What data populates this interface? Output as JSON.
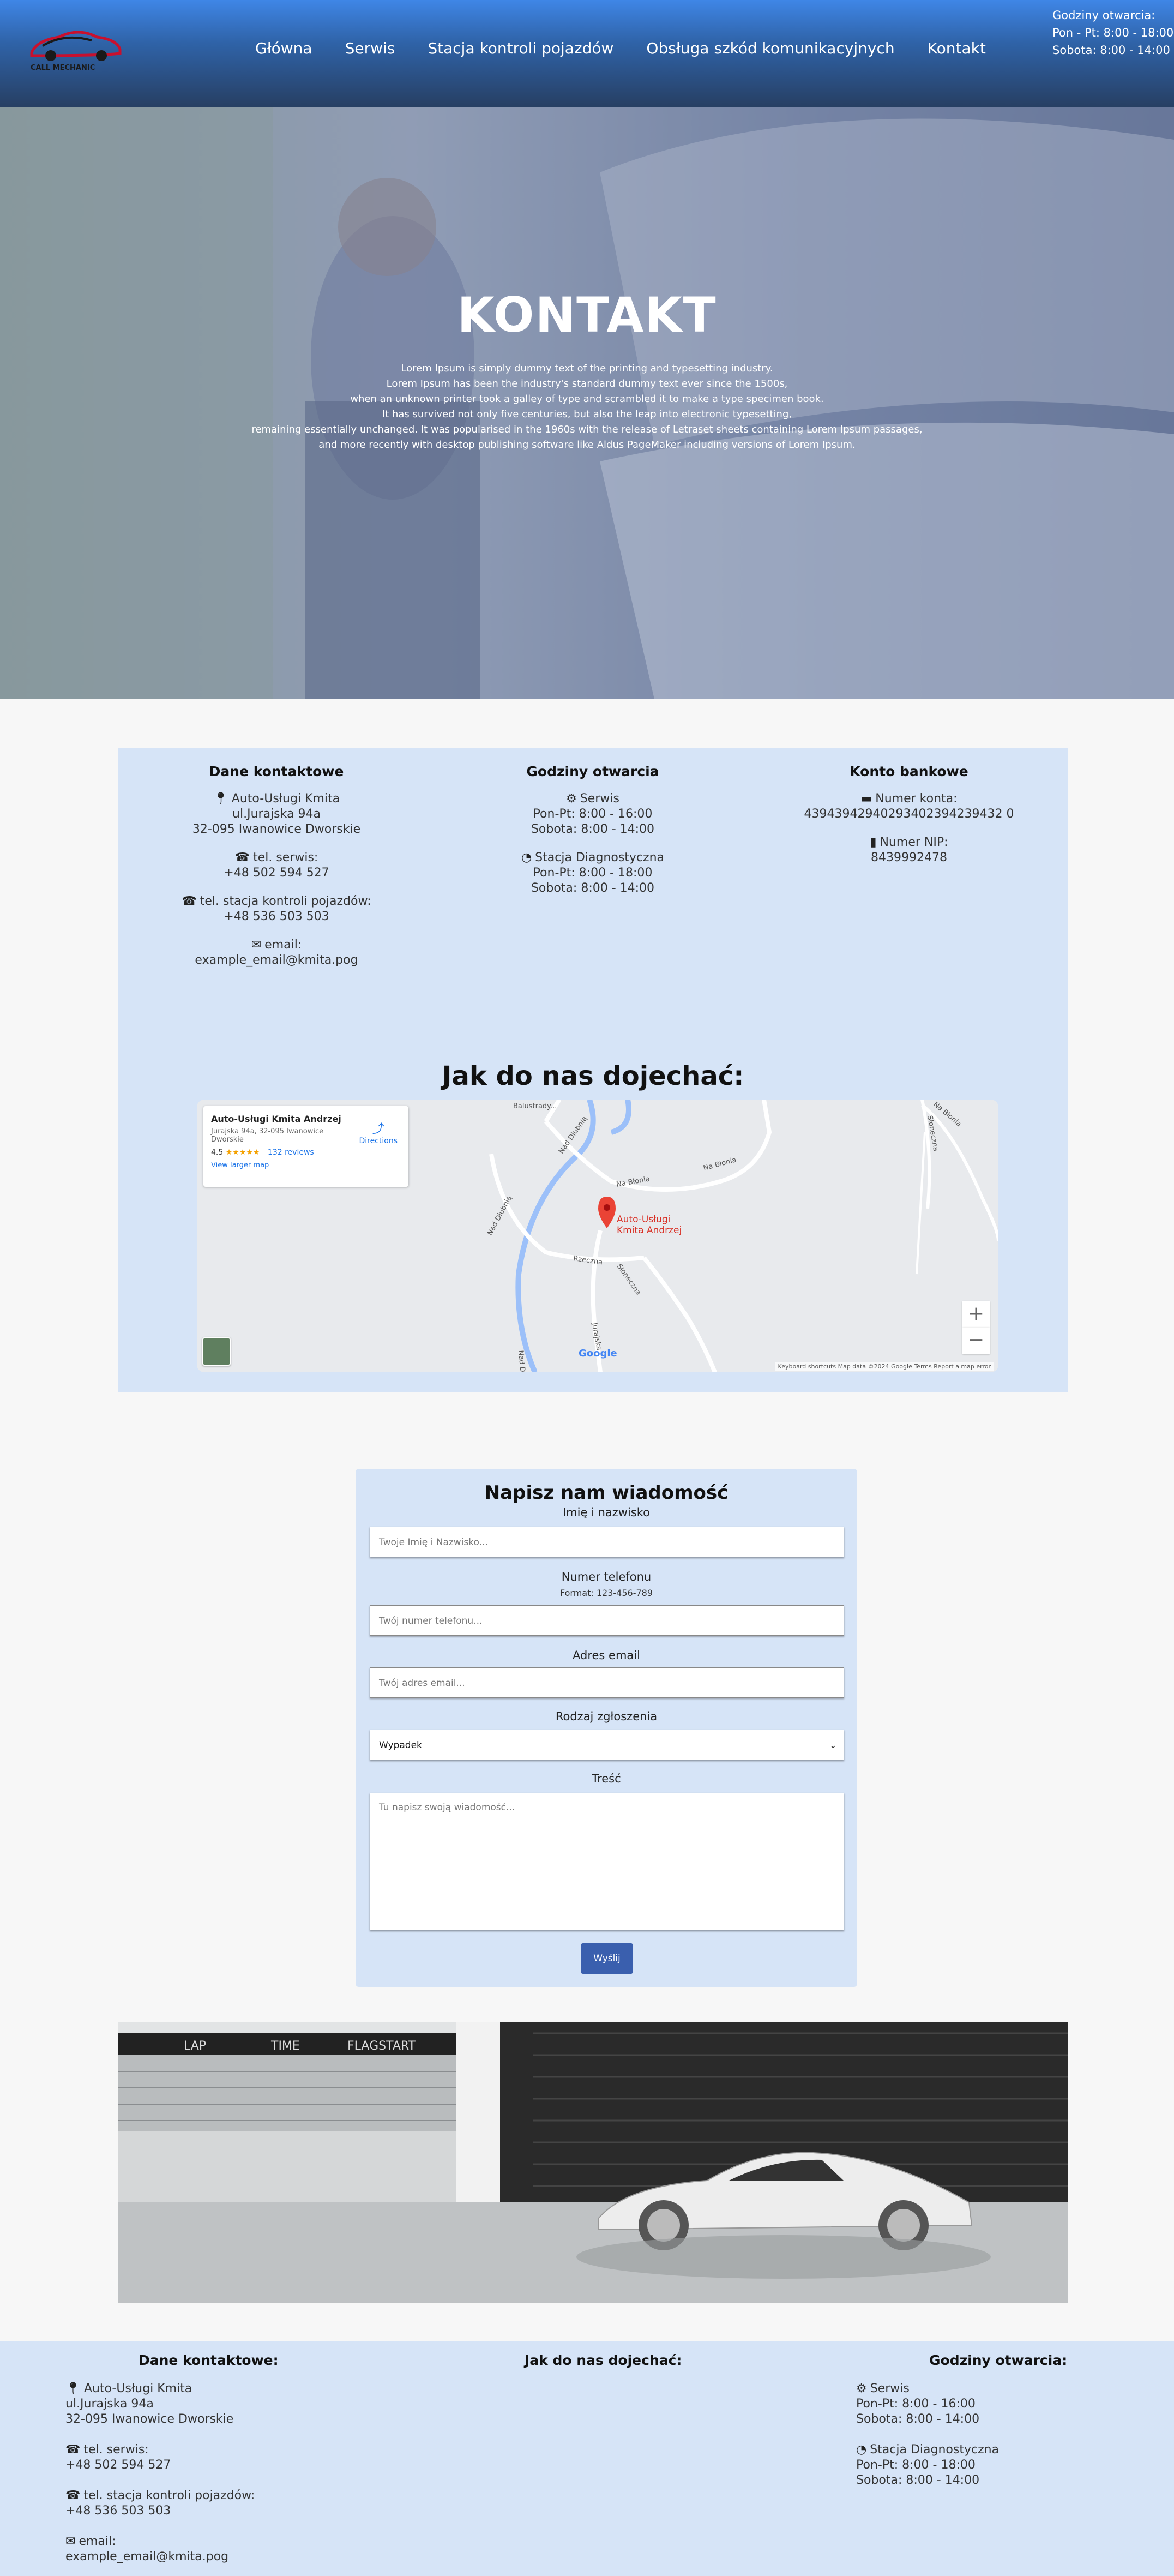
{
  "nav": {
    "logo_text": "CALL MECHANIC",
    "links": [
      "Główna",
      "Serwis",
      "Stacja kontroli pojazdów",
      "Obsługa szkód komunikacyjnych",
      "Kontakt"
    ],
    "hours_title": "Godziny otwarcia:",
    "hours_weekdays": "Pon - Pt: 8:00 - 18:00",
    "hours_saturday": "Sobota: 8:00 - 14:00"
  },
  "hero": {
    "title": "KONTAKT",
    "lines": [
      "Lorem Ipsum is simply dummy text of the printing and typesetting industry.",
      "Lorem Ipsum has been the industry's standard dummy text ever since the 1500s,",
      "when an unknown printer took a galley of type and scrambled it to make a type specimen book.",
      "It has survived not only five centuries, but also the leap into electronic typesetting,",
      "remaining essentially unchanged. It was popularised in the 1960s with the release of Letraset sheets containing Lorem Ipsum passages,",
      "and more recently with desktop publishing software like Aldus PageMaker including versions of Lorem Ipsum."
    ]
  },
  "contact": {
    "col1": {
      "title": "Dane kontaktowe",
      "company": "Auto-Usługi Kmita",
      "street": "ul.Jurajska 94a",
      "city": "32-095 Iwanowice Dworskie",
      "service_label": "tel. serwis:",
      "service_phone": "+48 502 594 527",
      "station_label": "tel. stacja kontroli pojazdów:",
      "station_phone": "+48 536 503 503",
      "email_label": "email:",
      "email": "example_email@kmita.pog"
    },
    "col2": {
      "title": "Godziny otwarcia",
      "service": "Serwis",
      "service_weekdays": "Pon-Pt: 8:00 - 16:00",
      "service_saturday": "Sobota: 8:00 - 14:00",
      "station": "Stacja Diagnostyczna",
      "station_weekdays": "Pon-Pt: 8:00 - 18:00",
      "station_saturday": "Sobota: 8:00 - 14:00"
    },
    "col3": {
      "title": "Konto bankowe",
      "account_label": "Numer konta:",
      "account": "43943942940293402394239432 0",
      "nip_label": "Numer NIP:",
      "nip": "8439992478"
    },
    "map_title": "Jak do nas dojechać:"
  },
  "map": {
    "place_name": "Auto-Usługi Kmita Andrzej",
    "address": "Jurajska 94a, 32-095 Iwanowice Dworskie",
    "rating": "4.5",
    "stars": "★★★★★",
    "reviews": "132 reviews",
    "larger": "View larger map",
    "directions": "Directions",
    "pin_label_1": "Auto-Usługi",
    "pin_label_2": "Kmita Andrzej",
    "roads": [
      "Balustrady...",
      "Nad Dłubnią",
      "Na Błonia",
      "Na Błonia",
      "Nad Dłubnią",
      "Rzeczna",
      "Słoneczna",
      "Jurajska",
      "Na Błonia",
      "Słoneczna",
      "Nad D..."
    ],
    "google": "Google",
    "footer": "Keyboard shortcuts   Map data ©2024 Google   Terms   Report a map error",
    "zoom_in": "+",
    "zoom_out": "−"
  },
  "form": {
    "title": "Napisz nam wiadomość",
    "name_label": "Imię i nazwisko",
    "name_placeholder": "Twoje Imię i Nazwisko...",
    "phone_label": "Numer telefonu",
    "phone_hint": "Format: 123-456-789",
    "phone_placeholder": "Twój numer telefonu...",
    "email_label": "Adres email",
    "email_placeholder": "Twój adres email...",
    "type_label": "Rodzaj zgłoszenia",
    "type_value": "Wypadek",
    "message_label": "Treść",
    "message_placeholder": "Tu napisz swoją wiadomość...",
    "submit": "Wyślij"
  },
  "photo": {
    "banners": [
      "LAP",
      "TIME",
      "FLAGSTART"
    ]
  },
  "footer": {
    "col1_title": "Dane kontaktowe:",
    "company": "Auto-Usługi Kmita",
    "street": "ul.Jurajska 94a",
    "city": "32-095 Iwanowice Dworskie",
    "service_label": "tel. serwis:",
    "service_phone": "+48 502 594 527",
    "station_label": "tel. stacja kontroli pojazdów:",
    "station_phone": "+48 536 503 503",
    "email_label": "email:",
    "email": "example_email@kmita.pog",
    "col2_title": "Jak do nas dojechać:",
    "col3_title": "Godziny otwarcia:",
    "service": "Serwis",
    "service_weekdays": "Pon-Pt: 8:00 - 16:00",
    "service_saturday": "Sobota: 8:00 - 14:00",
    "station": "Stacja Diagnostyczna",
    "station_weekdays": "Pon-Pt: 8:00 - 18:00",
    "station_saturday": "Sobota: 8:00 - 14:00"
  },
  "colors": {
    "nav_top": "#3f86e6",
    "panel": "#d6e4f7",
    "button": "#3a5fae",
    "pin": "#d93025"
  },
  "icons": [
    "map-marker-icon",
    "phone-icon",
    "envelope-icon",
    "gears-icon",
    "tachometer-icon",
    "credit-card-icon",
    "id-card-icon"
  ]
}
